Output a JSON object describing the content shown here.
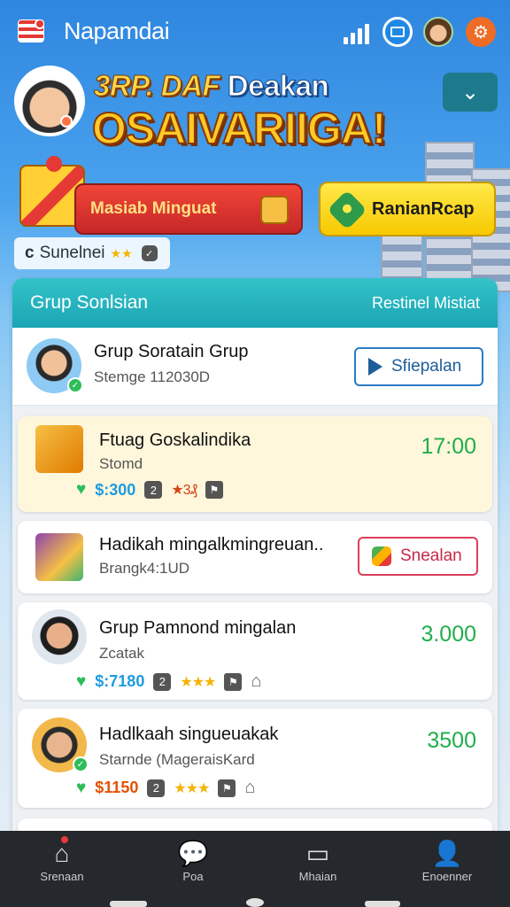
{
  "app": {
    "title": "Napamdai"
  },
  "banner": {
    "headline_part1": "3RP. DAF",
    "headline_part2": "Deakan",
    "headline_big": "OSAIVARIIGA!",
    "red_button": "Masiab Minguat",
    "yellow_button": "RanianRcap",
    "status_label": "Sunelnei",
    "status_prefix": "c",
    "dropdown_icon": "chevron-down"
  },
  "panel": {
    "title": "Grup Sonlsian",
    "action": "Restinel Mistiat"
  },
  "rows": [
    {
      "title": "Grup Soratain Grup",
      "sub": "Stemge 112030D",
      "button": "Sfiepalan"
    },
    {
      "title": "Ftuag Goskalindika",
      "sub": "Stomd",
      "price": "$:300",
      "box": "2",
      "stars": "★3₰",
      "amount": "17:00"
    },
    {
      "title": "Hadikah mingalkmingreuan..",
      "sub": "Brangk4:1UD",
      "button": "Snealan"
    },
    {
      "title": "Grup Pamnond mingalan",
      "sub": "Zcatak",
      "price": "$:7180",
      "box": "2",
      "stars": "★★★",
      "amount": "3.000"
    },
    {
      "title": "Hadlkaah singueuakak",
      "sub": "Starnde (MageraisKard",
      "price": "$1150",
      "box": "2",
      "stars": "★★★",
      "amount": "3500"
    }
  ],
  "nav": [
    {
      "label": "Srenaan",
      "icon": "home-icon"
    },
    {
      "label": "Poa",
      "icon": "chat-icon"
    },
    {
      "label": "Mhaian",
      "icon": "document-icon"
    },
    {
      "label": "Enoenner",
      "icon": "person-icon"
    }
  ],
  "colors": {
    "accent_teal": "#1aa6b4",
    "amount_green": "#1fae4b",
    "banner_yellow": "#ffc928",
    "banner_red": "#c62828"
  }
}
